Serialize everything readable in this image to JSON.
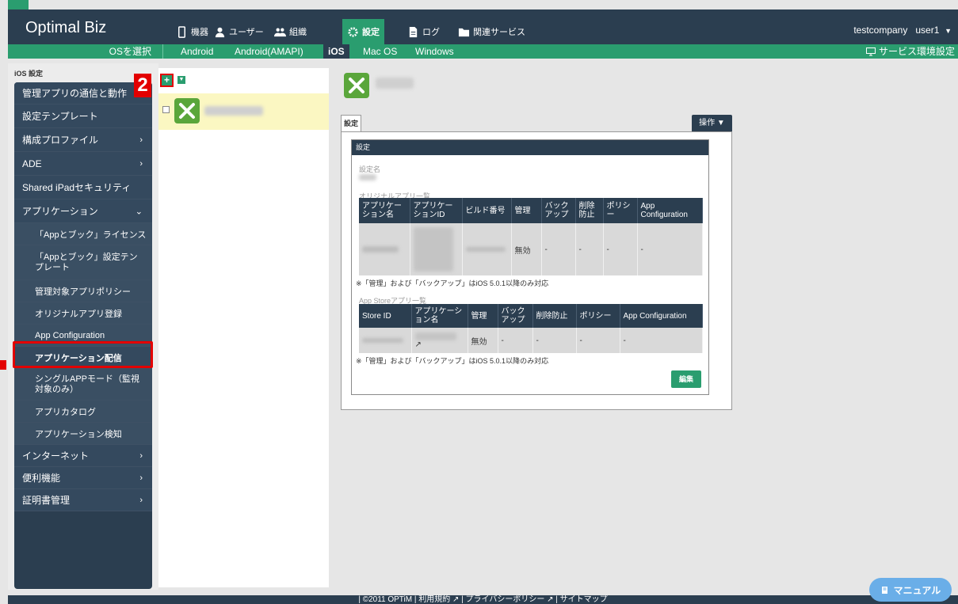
{
  "header": {
    "brand": "Optimal Biz",
    "nav": [
      {
        "label": "機器",
        "icon": "device-icon"
      },
      {
        "label": "ユーザー",
        "icon": "user-icon"
      },
      {
        "label": "組織",
        "icon": "group-icon"
      },
      {
        "label": "設定",
        "icon": "gear-icon"
      },
      {
        "label": "ログ",
        "icon": "document-icon"
      },
      {
        "label": "関連サービス",
        "icon": "folder-icon"
      }
    ],
    "company": "testcompany",
    "user": "user1",
    "user_caret": "▼"
  },
  "subheader": {
    "os_select": "OSを選択",
    "os_tabs": [
      "Android",
      "Android(AMAPI)",
      "iOS",
      "Mac OS",
      "Windows"
    ],
    "service_settings": "サービス環境設定"
  },
  "sidebar": {
    "title": "iOS 設定",
    "items": [
      {
        "label": "管理アプリの通信と動作",
        "arrow": ""
      },
      {
        "label": "設定テンプレート",
        "arrow": ""
      },
      {
        "label": "構成プロファイル",
        "arrow": "›"
      },
      {
        "label": "ADE",
        "arrow": "›"
      },
      {
        "label": "Shared iPadセキュリティ",
        "arrow": ""
      },
      {
        "label": "アプリケーション",
        "arrow": "⌄"
      },
      {
        "label": "「Appとブック」ライセンス",
        "arrow": ""
      },
      {
        "label": "「Appとブック」設定テンプレート",
        "arrow": ""
      },
      {
        "label": "管理対象アプリポリシー",
        "arrow": ""
      },
      {
        "label": "オリジナルアプリ登録",
        "arrow": ""
      },
      {
        "label": "App Configuration",
        "arrow": ""
      },
      {
        "label": "アプリケーション配信",
        "arrow": ""
      },
      {
        "label": "シングルAPPモード（監視対象のみ）",
        "arrow": ""
      },
      {
        "label": "アプリカタログ",
        "arrow": ""
      },
      {
        "label": "アプリケーション検知",
        "arrow": ""
      },
      {
        "label": "インターネット",
        "arrow": "›"
      },
      {
        "label": "便利機能",
        "arrow": "›"
      },
      {
        "label": "証明書管理",
        "arrow": "›"
      }
    ]
  },
  "annotations": {
    "step2": "2"
  },
  "list": {
    "add_label": "+",
    "dropdown": "▼"
  },
  "detail": {
    "tab_label": "設定",
    "ops_label": "操作 ▼",
    "section_title": "設定",
    "name_label": "設定名",
    "original_apps_label": "オリジナルアプリ一覧",
    "original_headers": [
      "アプリケーション名",
      "アプリケーションID",
      "ビルド番号",
      "管理",
      "バックアップ",
      "削除防止",
      "ポリシー",
      "App Configuration"
    ],
    "original_row": [
      "",
      "",
      "",
      "無効",
      "-",
      "-",
      "-",
      "-"
    ],
    "note1": "※「管理」および「バックアップ」はiOS 5.0.1以降のみ対応",
    "store_apps_label": "App Storeアプリ一覧",
    "store_headers": [
      "Store ID",
      "アプリケーション名",
      "管理",
      "バックアップ",
      "削除防止",
      "ポリシー",
      "App Configuration"
    ],
    "store_row": [
      "",
      "",
      "無効",
      "-",
      "-",
      "-",
      "-"
    ],
    "note2": "※「管理」および「バックアップ」はiOS 5.0.1以降のみ対応",
    "edit_label": "編集"
  },
  "footer": {
    "text": "| ©2011 OPTiM | 利用規約 ↗ | プライバシーポリシー ↗ | サイトマップ"
  },
  "manual": {
    "label": "マニュアル"
  },
  "colors": {
    "navy": "#2b3e50",
    "green": "#2a9d6f",
    "highlight_red": "#e30000",
    "selected_row": "#fbf7c2"
  }
}
